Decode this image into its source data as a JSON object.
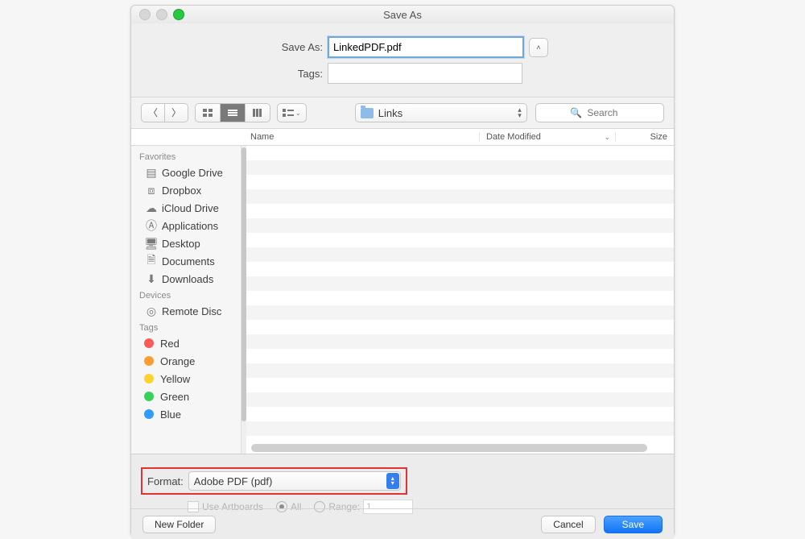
{
  "window": {
    "title": "Save As"
  },
  "form": {
    "saveas_label": "Save As:",
    "saveas_value": "LinkedPDF.pdf",
    "tags_label": "Tags:",
    "tags_value": "",
    "collapse_caret": "˄"
  },
  "toolbar": {
    "location_folder": "Links",
    "search_placeholder": "Search"
  },
  "columns": {
    "name": "Name",
    "date": "Date Modified",
    "size": "Size"
  },
  "sidebar": {
    "sections": {
      "favorites": {
        "title": "Favorites",
        "items": [
          "Google Drive",
          "Dropbox",
          "iCloud Drive",
          "Applications",
          "Desktop",
          "Documents",
          "Downloads"
        ]
      },
      "devices": {
        "title": "Devices",
        "items": [
          "Remote Disc"
        ]
      },
      "tags": {
        "title": "Tags",
        "items": [
          {
            "label": "Red",
            "color": "#ff5b56"
          },
          {
            "label": "Orange",
            "color": "#ff9b2f"
          },
          {
            "label": "Yellow",
            "color": "#ffd12f"
          },
          {
            "label": "Green",
            "color": "#36d15a"
          },
          {
            "label": "Blue",
            "color": "#2f9dff"
          }
        ]
      }
    }
  },
  "format": {
    "label": "Format:",
    "selected": "Adobe PDF (pdf)",
    "options": {
      "use_artboards": "Use Artboards",
      "all": "All",
      "range": "Range:",
      "range_value": "1"
    }
  },
  "footer": {
    "new_folder": "New Folder",
    "cancel": "Cancel",
    "save": "Save"
  },
  "icons": {
    "google_drive": "▤",
    "dropbox": "⧈",
    "icloud": "☁",
    "applications": "Ⓐ",
    "desktop": "🖥",
    "documents": "🗎",
    "downloads": "⬇",
    "remote_disc": "◎"
  }
}
